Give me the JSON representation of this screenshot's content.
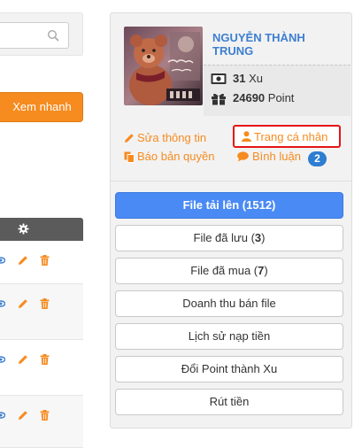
{
  "quick_view": {
    "label": "Xem nhanh"
  },
  "user": {
    "name": "NGUYỄN THÀNH TRUNG",
    "xu_value": "31",
    "xu_unit": "Xu",
    "point_value": "24690",
    "point_unit": "Point"
  },
  "links": {
    "edit_info": "Sửa thông tin",
    "profile": "Trang cá nhân",
    "copyright": "Báo bản quyền",
    "comments": "Bình luận",
    "comments_count": "2"
  },
  "menu": {
    "uploaded": {
      "label": "File tải lên",
      "count": "1512"
    },
    "saved": {
      "label": "File đã lưu",
      "count": "3"
    },
    "purchased": {
      "label": "File đã mua",
      "count": "7"
    },
    "revenue": {
      "label": "Doanh thu bán file"
    },
    "topup_history": {
      "label": "Lịch sử nạp tiền"
    },
    "convert": {
      "label": "Đổi Point thành Xu"
    },
    "withdraw": {
      "label": "Rút tiền"
    }
  },
  "colors": {
    "accent_orange": "#f68b1f",
    "accent_blue": "#4a8af4",
    "name_blue": "#3d7fd1",
    "highlight_red": "#e51515"
  },
  "icons": [
    "search-icon",
    "gear-icon",
    "eye-icon",
    "pencil-icon",
    "trash-icon",
    "money-icon",
    "gift-icon",
    "user-icon",
    "copy-icon",
    "comment-icon"
  ]
}
